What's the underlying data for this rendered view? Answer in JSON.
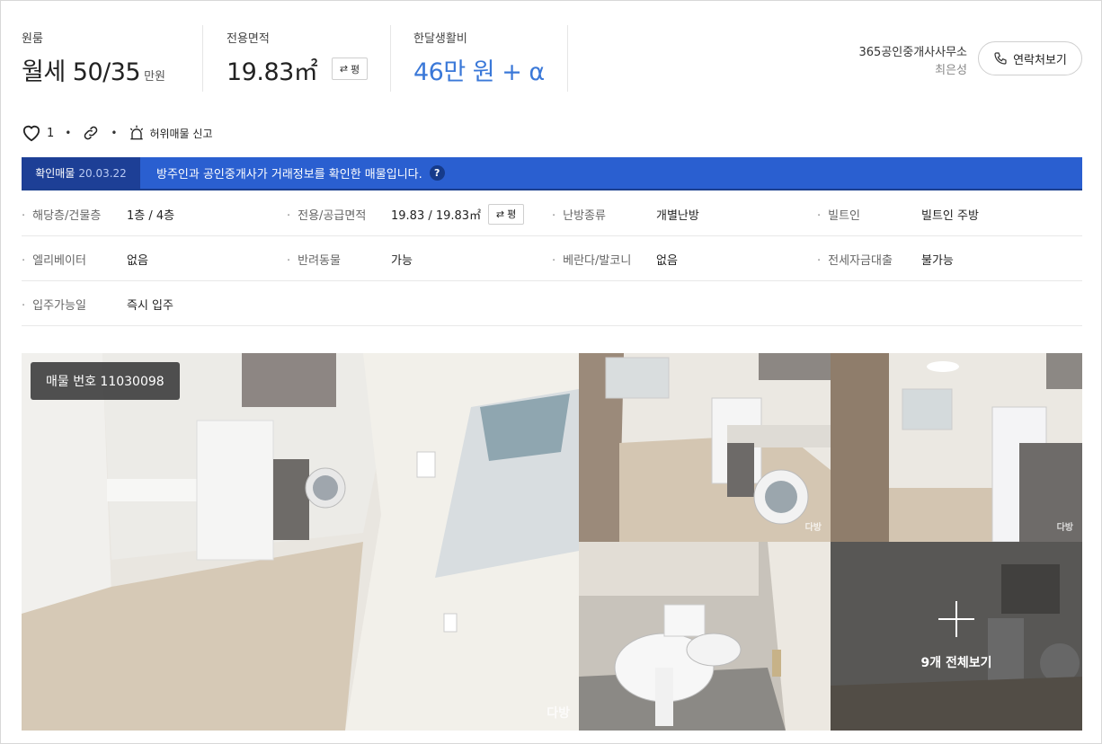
{
  "header": {
    "type_label": "원룸",
    "price_value": "월세 50/35",
    "price_unit": "만원",
    "area_label": "전용면적",
    "area_value": "19.83㎡",
    "area_convert_label": "평",
    "cost_label": "한달생활비",
    "cost_value": "46만 원 + α"
  },
  "agent": {
    "office": "365공인중개사사무소",
    "person": "최은성",
    "contact_label": "연락처보기"
  },
  "actions": {
    "like_count": "1",
    "report_label": "허위매물 신고"
  },
  "banner": {
    "verified_label": "확인매물",
    "verified_date": "20.03.22",
    "message": "방주인과 공인중개사가 거래정보를 확인한 매물입니다.",
    "help": "?"
  },
  "details": {
    "rows": [
      [
        {
          "label": "해당층/건물층",
          "value": "1층 / 4층"
        },
        {
          "label": "전용/공급면적",
          "value": "19.83 / 19.83㎡",
          "convert": "평"
        },
        {
          "label": "난방종류",
          "value": "개별난방"
        },
        {
          "label": "빌트인",
          "value": "빌트인 주방"
        }
      ],
      [
        {
          "label": "엘리베이터",
          "value": "없음"
        },
        {
          "label": "반려동물",
          "value": "가능"
        },
        {
          "label": "베란다/발코니",
          "value": "없음"
        },
        {
          "label": "전세자금대출",
          "value": "불가능"
        }
      ],
      [
        {
          "label": "입주가능일",
          "value": "즉시 입주"
        }
      ]
    ]
  },
  "gallery": {
    "listing_badge": "매물 번호 11030098",
    "more_label": "9개 전체보기",
    "watermark": "다방"
  },
  "colors": {
    "accent_blue": "#3a78d8",
    "banner_blue": "#2a5fd0",
    "banner_dark": "#1d3f96"
  }
}
